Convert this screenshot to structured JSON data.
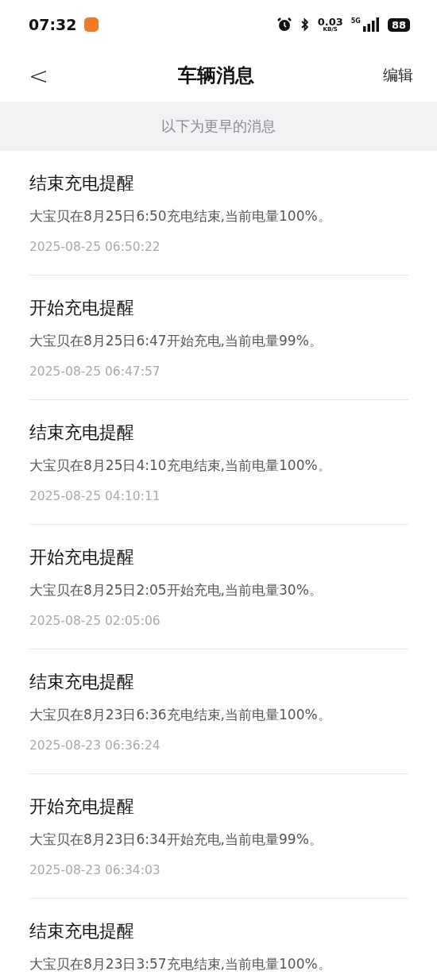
{
  "status_bar": {
    "time": "07:32",
    "net_speed": "0.03",
    "net_unit": "KB/S",
    "network": "5G",
    "battery": "88"
  },
  "nav": {
    "back": "<",
    "title": "车辆消息",
    "action": "编辑"
  },
  "banner": "以下为更早的消息",
  "messages": [
    {
      "title": "结束充电提醒",
      "body": "大宝贝在8月25日6:50充电结束,当前电量100%。",
      "time": "2025-08-25 06:50:22"
    },
    {
      "title": "开始充电提醒",
      "body": "大宝贝在8月25日6:47开始充电,当前电量99%。",
      "time": "2025-08-25 06:47:57"
    },
    {
      "title": "结束充电提醒",
      "body": "大宝贝在8月25日4:10充电结束,当前电量100%。",
      "time": "2025-08-25 04:10:11"
    },
    {
      "title": "开始充电提醒",
      "body": "大宝贝在8月25日2:05开始充电,当前电量30%。",
      "time": "2025-08-25 02:05:06"
    },
    {
      "title": "结束充电提醒",
      "body": "大宝贝在8月23日6:36充电结束,当前电量100%。",
      "time": "2025-08-23 06:36:24"
    },
    {
      "title": "开始充电提醒",
      "body": "大宝贝在8月23日6:34开始充电,当前电量99%。",
      "time": "2025-08-23 06:34:03"
    },
    {
      "title": "结束充电提醒",
      "body": "大宝贝在8月23日3:57充电结束,当前电量100%。"
    }
  ]
}
